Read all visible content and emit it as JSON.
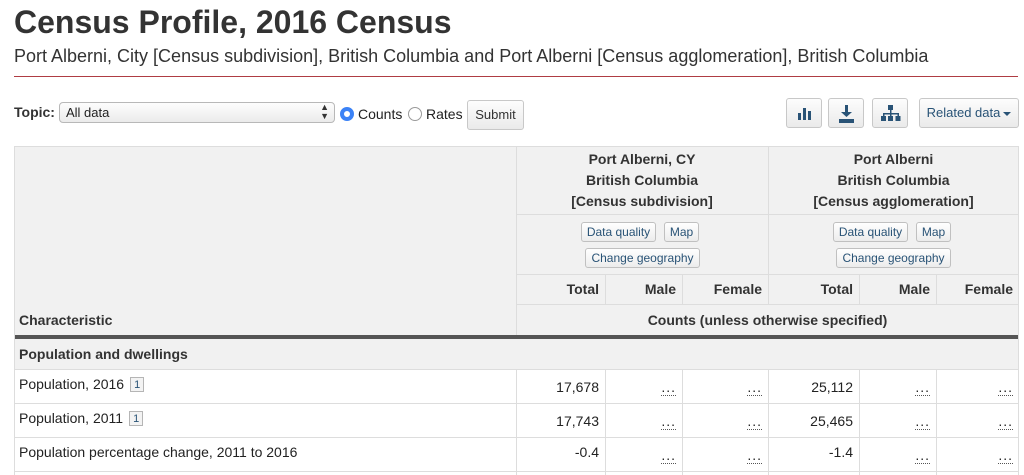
{
  "header": {
    "title": "Census Profile, 2016 Census",
    "subtitle": "Port Alberni, City [Census subdivision], British Columbia and Port Alberni [Census agglomeration], British Columbia"
  },
  "toolbar": {
    "topic_label": "Topic:",
    "topic_value": "All data",
    "radio_counts": "Counts",
    "radio_rates": "Rates",
    "submit_label": "Submit",
    "related_label": "Related data"
  },
  "icons": [
    "bar-chart-icon",
    "download-icon",
    "hierarchy-icon"
  ],
  "table": {
    "geo1": {
      "line1": "Port Alberni, CY",
      "line2": "British Columbia",
      "line3": "[Census subdivision]"
    },
    "geo2": {
      "line1": "Port Alberni",
      "line2": "British Columbia",
      "line3": "[Census agglomeration]"
    },
    "btn_data_quality": "Data quality",
    "btn_map": "Map",
    "btn_change_geography": "Change geography",
    "col_total": "Total",
    "col_male": "Male",
    "col_female": "Female",
    "characteristic_label": "Characteristic",
    "counts_label": "Counts (unless otherwise specified)",
    "section_title": "Population and dwellings",
    "rows": [
      {
        "label": "Population, 2016",
        "footnote": "1",
        "cy_total": "17,678",
        "cy_male": "...",
        "cy_female": "...",
        "ca_total": "25,112",
        "ca_male": "...",
        "ca_female": "..."
      },
      {
        "label": "Population, 2011",
        "footnote": "1",
        "cy_total": "17,743",
        "cy_male": "...",
        "cy_female": "...",
        "ca_total": "25,465",
        "ca_male": "...",
        "ca_female": "..."
      },
      {
        "label": "Population percentage change, 2011 to 2016",
        "footnote": "",
        "cy_total": "-0.4",
        "cy_male": "...",
        "cy_female": "...",
        "ca_total": "-1.4",
        "ca_male": "...",
        "ca_female": "..."
      }
    ]
  },
  "colors": {
    "accent_rule": "#af3c43",
    "link": "#295376",
    "radio": "#3b82f6"
  }
}
